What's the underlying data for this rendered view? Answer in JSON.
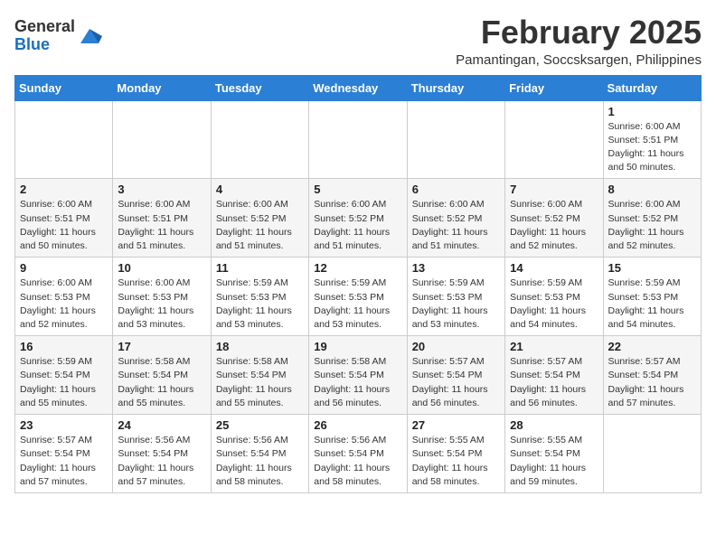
{
  "header": {
    "logo_general": "General",
    "logo_blue": "Blue",
    "month_year": "February 2025",
    "location": "Pamantingan, Soccsksargen, Philippines"
  },
  "days_of_week": [
    "Sunday",
    "Monday",
    "Tuesday",
    "Wednesday",
    "Thursday",
    "Friday",
    "Saturday"
  ],
  "weeks": [
    [
      {
        "day": "",
        "info": ""
      },
      {
        "day": "",
        "info": ""
      },
      {
        "day": "",
        "info": ""
      },
      {
        "day": "",
        "info": ""
      },
      {
        "day": "",
        "info": ""
      },
      {
        "day": "",
        "info": ""
      },
      {
        "day": "1",
        "info": "Sunrise: 6:00 AM\nSunset: 5:51 PM\nDaylight: 11 hours and 50 minutes."
      }
    ],
    [
      {
        "day": "2",
        "info": "Sunrise: 6:00 AM\nSunset: 5:51 PM\nDaylight: 11 hours and 50 minutes."
      },
      {
        "day": "3",
        "info": "Sunrise: 6:00 AM\nSunset: 5:51 PM\nDaylight: 11 hours and 51 minutes."
      },
      {
        "day": "4",
        "info": "Sunrise: 6:00 AM\nSunset: 5:52 PM\nDaylight: 11 hours and 51 minutes."
      },
      {
        "day": "5",
        "info": "Sunrise: 6:00 AM\nSunset: 5:52 PM\nDaylight: 11 hours and 51 minutes."
      },
      {
        "day": "6",
        "info": "Sunrise: 6:00 AM\nSunset: 5:52 PM\nDaylight: 11 hours and 51 minutes."
      },
      {
        "day": "7",
        "info": "Sunrise: 6:00 AM\nSunset: 5:52 PM\nDaylight: 11 hours and 52 minutes."
      },
      {
        "day": "8",
        "info": "Sunrise: 6:00 AM\nSunset: 5:52 PM\nDaylight: 11 hours and 52 minutes."
      }
    ],
    [
      {
        "day": "9",
        "info": "Sunrise: 6:00 AM\nSunset: 5:53 PM\nDaylight: 11 hours and 52 minutes."
      },
      {
        "day": "10",
        "info": "Sunrise: 6:00 AM\nSunset: 5:53 PM\nDaylight: 11 hours and 53 minutes."
      },
      {
        "day": "11",
        "info": "Sunrise: 5:59 AM\nSunset: 5:53 PM\nDaylight: 11 hours and 53 minutes."
      },
      {
        "day": "12",
        "info": "Sunrise: 5:59 AM\nSunset: 5:53 PM\nDaylight: 11 hours and 53 minutes."
      },
      {
        "day": "13",
        "info": "Sunrise: 5:59 AM\nSunset: 5:53 PM\nDaylight: 11 hours and 53 minutes."
      },
      {
        "day": "14",
        "info": "Sunrise: 5:59 AM\nSunset: 5:53 PM\nDaylight: 11 hours and 54 minutes."
      },
      {
        "day": "15",
        "info": "Sunrise: 5:59 AM\nSunset: 5:53 PM\nDaylight: 11 hours and 54 minutes."
      }
    ],
    [
      {
        "day": "16",
        "info": "Sunrise: 5:59 AM\nSunset: 5:54 PM\nDaylight: 11 hours and 55 minutes."
      },
      {
        "day": "17",
        "info": "Sunrise: 5:58 AM\nSunset: 5:54 PM\nDaylight: 11 hours and 55 minutes."
      },
      {
        "day": "18",
        "info": "Sunrise: 5:58 AM\nSunset: 5:54 PM\nDaylight: 11 hours and 55 minutes."
      },
      {
        "day": "19",
        "info": "Sunrise: 5:58 AM\nSunset: 5:54 PM\nDaylight: 11 hours and 56 minutes."
      },
      {
        "day": "20",
        "info": "Sunrise: 5:57 AM\nSunset: 5:54 PM\nDaylight: 11 hours and 56 minutes."
      },
      {
        "day": "21",
        "info": "Sunrise: 5:57 AM\nSunset: 5:54 PM\nDaylight: 11 hours and 56 minutes."
      },
      {
        "day": "22",
        "info": "Sunrise: 5:57 AM\nSunset: 5:54 PM\nDaylight: 11 hours and 57 minutes."
      }
    ],
    [
      {
        "day": "23",
        "info": "Sunrise: 5:57 AM\nSunset: 5:54 PM\nDaylight: 11 hours and 57 minutes."
      },
      {
        "day": "24",
        "info": "Sunrise: 5:56 AM\nSunset: 5:54 PM\nDaylight: 11 hours and 57 minutes."
      },
      {
        "day": "25",
        "info": "Sunrise: 5:56 AM\nSunset: 5:54 PM\nDaylight: 11 hours and 58 minutes."
      },
      {
        "day": "26",
        "info": "Sunrise: 5:56 AM\nSunset: 5:54 PM\nDaylight: 11 hours and 58 minutes."
      },
      {
        "day": "27",
        "info": "Sunrise: 5:55 AM\nSunset: 5:54 PM\nDaylight: 11 hours and 58 minutes."
      },
      {
        "day": "28",
        "info": "Sunrise: 5:55 AM\nSunset: 5:54 PM\nDaylight: 11 hours and 59 minutes."
      },
      {
        "day": "",
        "info": ""
      }
    ]
  ]
}
